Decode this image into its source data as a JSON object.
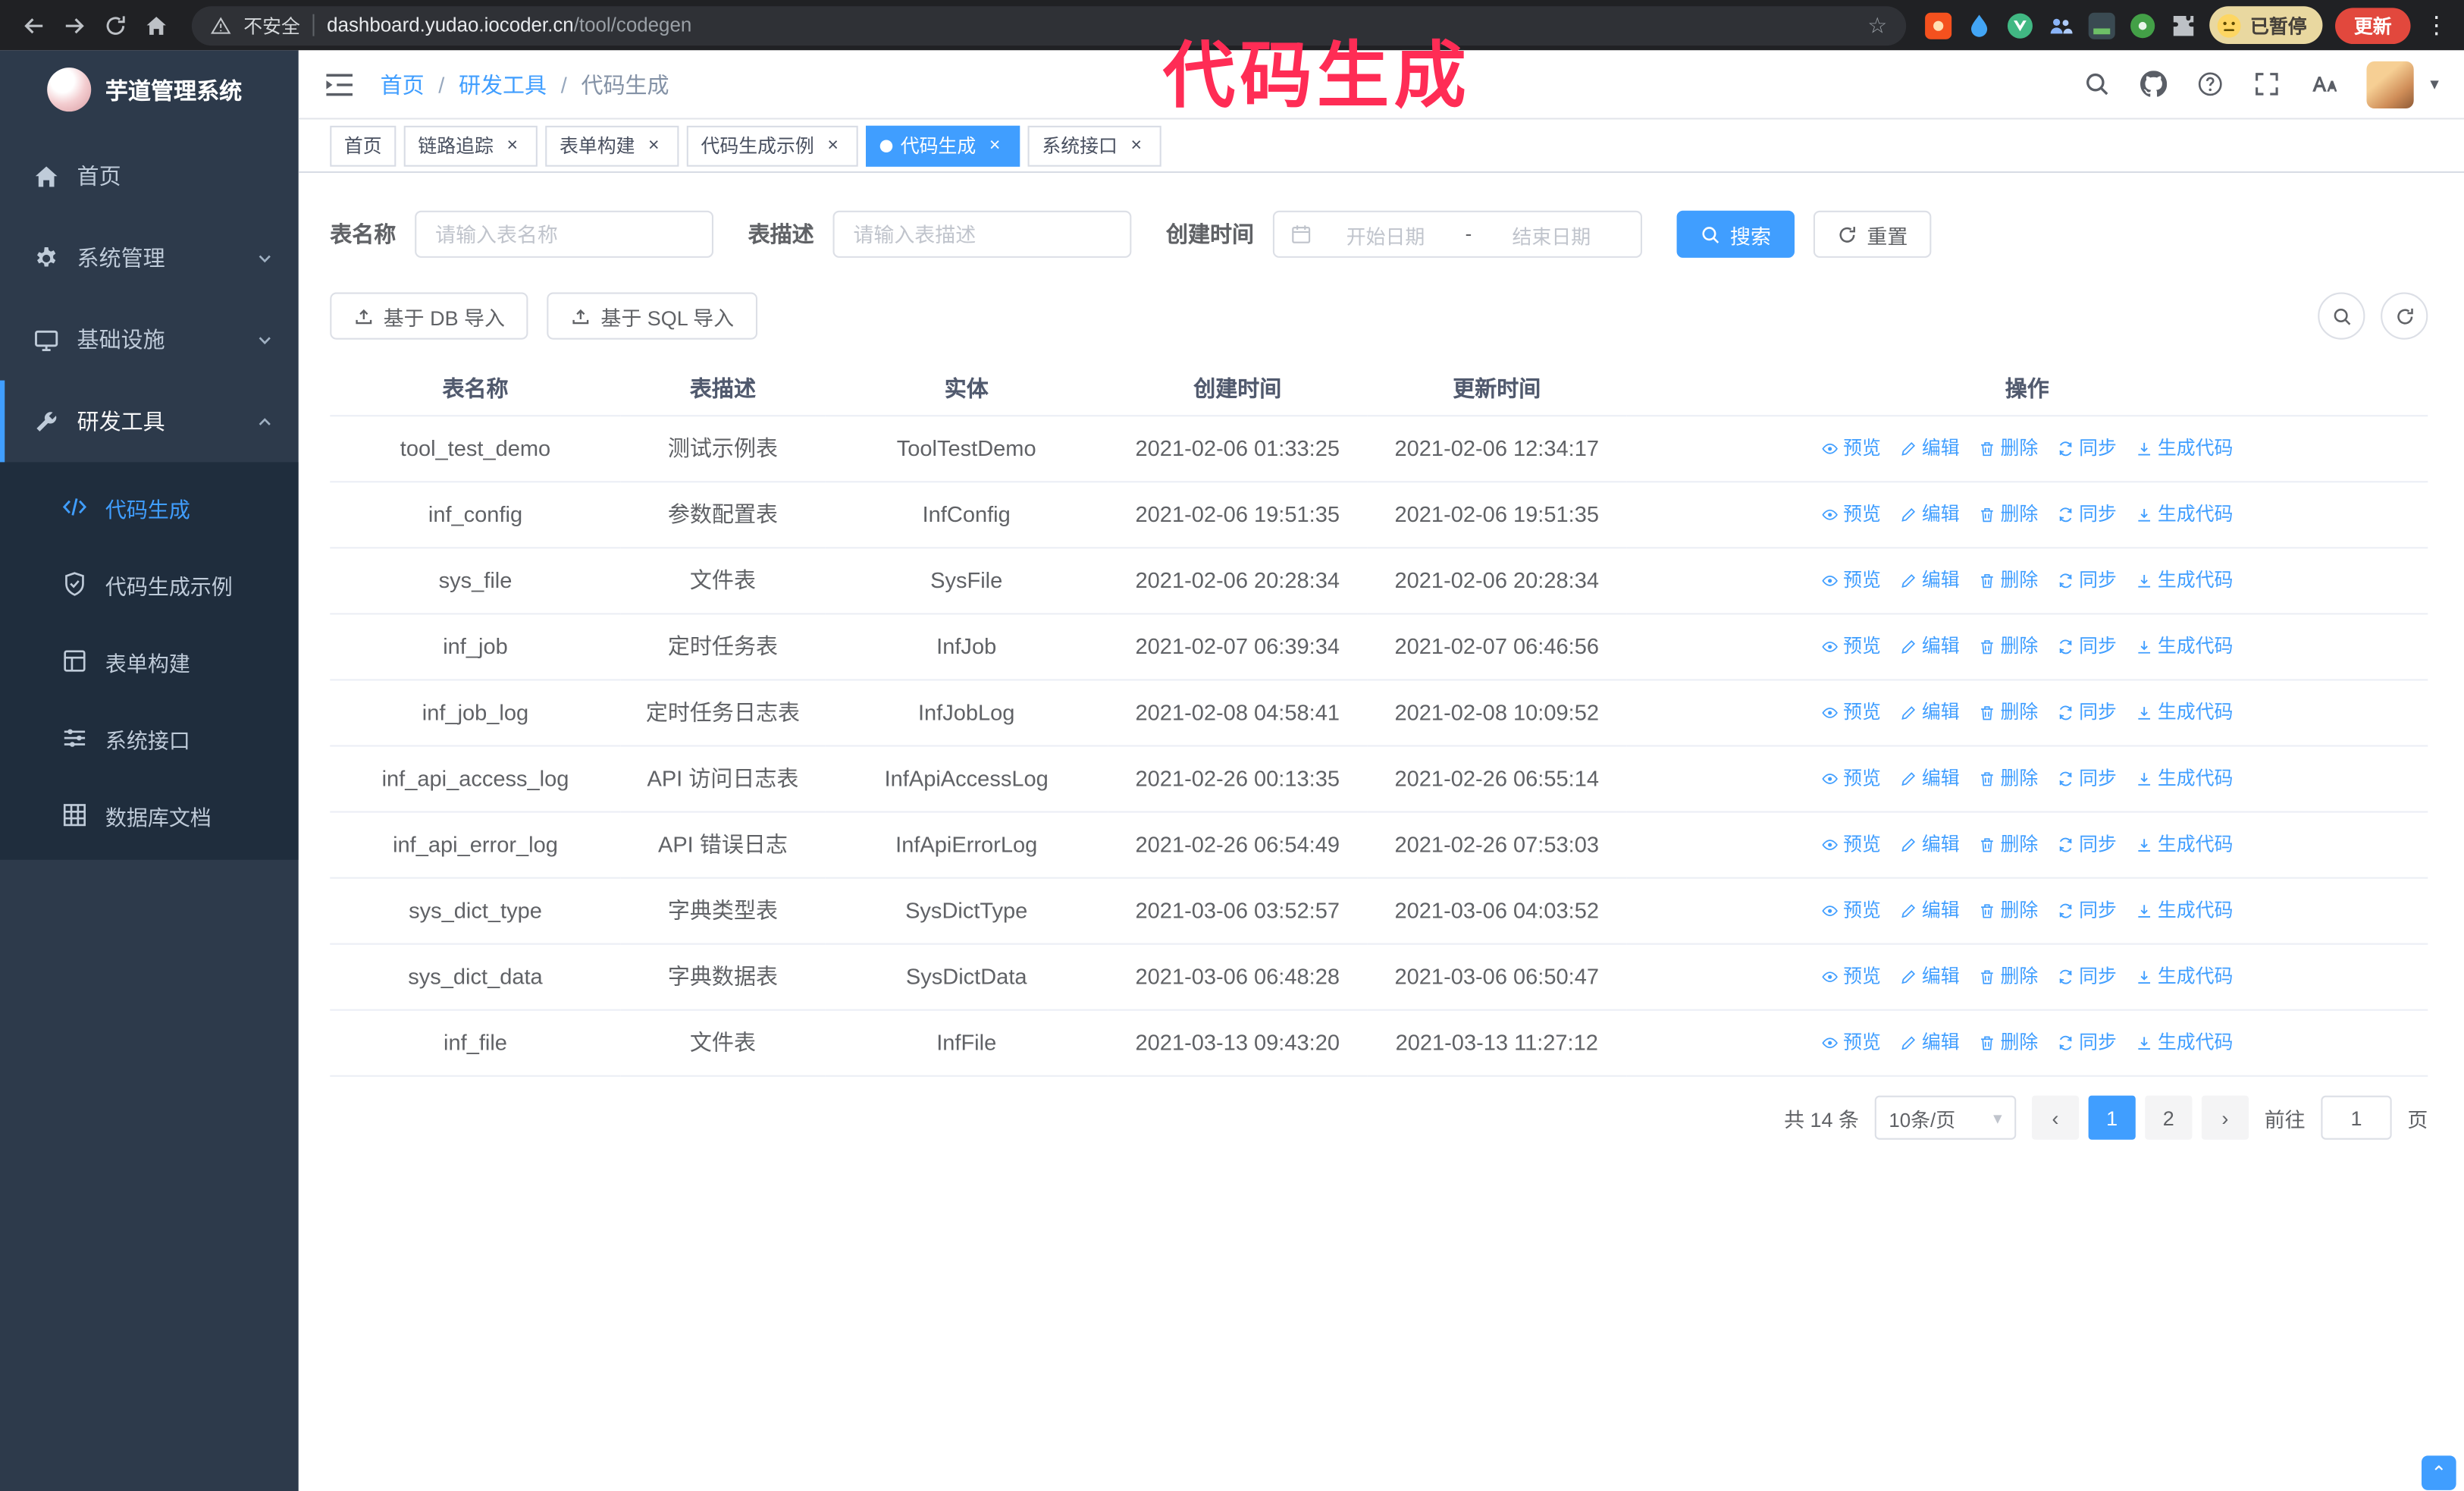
{
  "browser": {
    "security_text": "不安全",
    "url_domain": "dashboard.yudao.iocoder.cn",
    "url_path": "/tool/codegen",
    "profile_badge": "已暂停",
    "update_button": "更新"
  },
  "annotation": {
    "text": "代码生成"
  },
  "colors": {
    "primary": "#409eff",
    "annotation": "#ff2c55",
    "sidebar_bg": "#2d3a4b",
    "submenu_bg": "#1f2d3d"
  },
  "sidebar": {
    "logo_title": "芋道管理系统",
    "items": [
      {
        "key": "home",
        "label": "首页",
        "icon": "home-icon"
      },
      {
        "key": "system",
        "label": "系统管理",
        "icon": "gear-icon",
        "state": "collapsed"
      },
      {
        "key": "infra",
        "label": "基础设施",
        "icon": "monitor-icon",
        "state": "collapsed"
      },
      {
        "key": "dev-tools",
        "label": "研发工具",
        "icon": "wrench-icon",
        "state": "expanded"
      }
    ],
    "submenu": [
      {
        "key": "codegen",
        "label": "代码生成",
        "icon": "code-icon",
        "active": true
      },
      {
        "key": "codegen-demo",
        "label": "代码生成示例",
        "icon": "shield-icon",
        "active": false
      },
      {
        "key": "form-builder",
        "label": "表单构建",
        "icon": "form-icon",
        "active": false
      },
      {
        "key": "api",
        "label": "系统接口",
        "icon": "sliders-icon",
        "active": false
      },
      {
        "key": "db-doc",
        "label": "数据库文档",
        "icon": "grid-icon",
        "active": false
      }
    ]
  },
  "header": {
    "breadcrumb": [
      "首页",
      "研发工具",
      "代码生成"
    ],
    "separator": "/"
  },
  "tabs": [
    {
      "key": "home",
      "label": "首页",
      "closable": false,
      "active": false
    },
    {
      "key": "tracer",
      "label": "链路追踪",
      "closable": true,
      "active": false
    },
    {
      "key": "form-builder",
      "label": "表单构建",
      "closable": true,
      "active": false
    },
    {
      "key": "codegen-demo",
      "label": "代码生成示例",
      "closable": true,
      "active": false
    },
    {
      "key": "codegen",
      "label": "代码生成",
      "closable": true,
      "active": true
    },
    {
      "key": "api",
      "label": "系统接口",
      "closable": true,
      "active": false
    }
  ],
  "filters": {
    "table_name_label": "表名称",
    "table_name_placeholder": "请输入表名称",
    "table_desc_label": "表描述",
    "table_desc_placeholder": "请输入表描述",
    "create_time_label": "创建时间",
    "date_start_placeholder": "开始日期",
    "date_separator": "-",
    "date_end_placeholder": "结束日期",
    "search_button": "搜索",
    "reset_button": "重置"
  },
  "toolbar": {
    "import_db": "基于 DB 导入",
    "import_sql": "基于 SQL 导入"
  },
  "table": {
    "columns": [
      "表名称",
      "表描述",
      "实体",
      "创建时间",
      "更新时间",
      "操作"
    ],
    "actions": [
      "预览",
      "编辑",
      "删除",
      "同步",
      "生成代码"
    ],
    "rows": [
      {
        "name": "tool_test_demo",
        "desc": "测试示例表",
        "entity": "ToolTestDemo",
        "created": "2021-02-06 01:33:25",
        "updated": "2021-02-06 12:34:17"
      },
      {
        "name": "inf_config",
        "desc": "参数配置表",
        "entity": "InfConfig",
        "created": "2021-02-06 19:51:35",
        "updated": "2021-02-06 19:51:35"
      },
      {
        "name": "sys_file",
        "desc": "文件表",
        "entity": "SysFile",
        "created": "2021-02-06 20:28:34",
        "updated": "2021-02-06 20:28:34"
      },
      {
        "name": "inf_job",
        "desc": "定时任务表",
        "entity": "InfJob",
        "created": "2021-02-07 06:39:34",
        "updated": "2021-02-07 06:46:56"
      },
      {
        "name": "inf_job_log",
        "desc": "定时任务日志表",
        "entity": "InfJobLog",
        "created": "2021-02-08 04:58:41",
        "updated": "2021-02-08 10:09:52"
      },
      {
        "name": "inf_api_access_log",
        "desc": "API 访问日志表",
        "entity": "InfApiAccessLog",
        "created": "2021-02-26 00:13:35",
        "updated": "2021-02-26 06:55:14"
      },
      {
        "name": "inf_api_error_log",
        "desc": "API 错误日志",
        "entity": "InfApiErrorLog",
        "created": "2021-02-26 06:54:49",
        "updated": "2021-02-26 07:53:03"
      },
      {
        "name": "sys_dict_type",
        "desc": "字典类型表",
        "entity": "SysDictType",
        "created": "2021-03-06 03:52:57",
        "updated": "2021-03-06 04:03:52"
      },
      {
        "name": "sys_dict_data",
        "desc": "字典数据表",
        "entity": "SysDictData",
        "created": "2021-03-06 06:48:28",
        "updated": "2021-03-06 06:50:47"
      },
      {
        "name": "inf_file",
        "desc": "文件表",
        "entity": "InfFile",
        "created": "2021-03-13 09:43:20",
        "updated": "2021-03-13 11:27:12"
      }
    ]
  },
  "pagination": {
    "total": "共 14 条",
    "page_size": "10条/页",
    "pages": [
      "1",
      "2"
    ],
    "active_page": "1",
    "goto_label": "前往",
    "goto_value": "1",
    "goto_unit": "页"
  }
}
